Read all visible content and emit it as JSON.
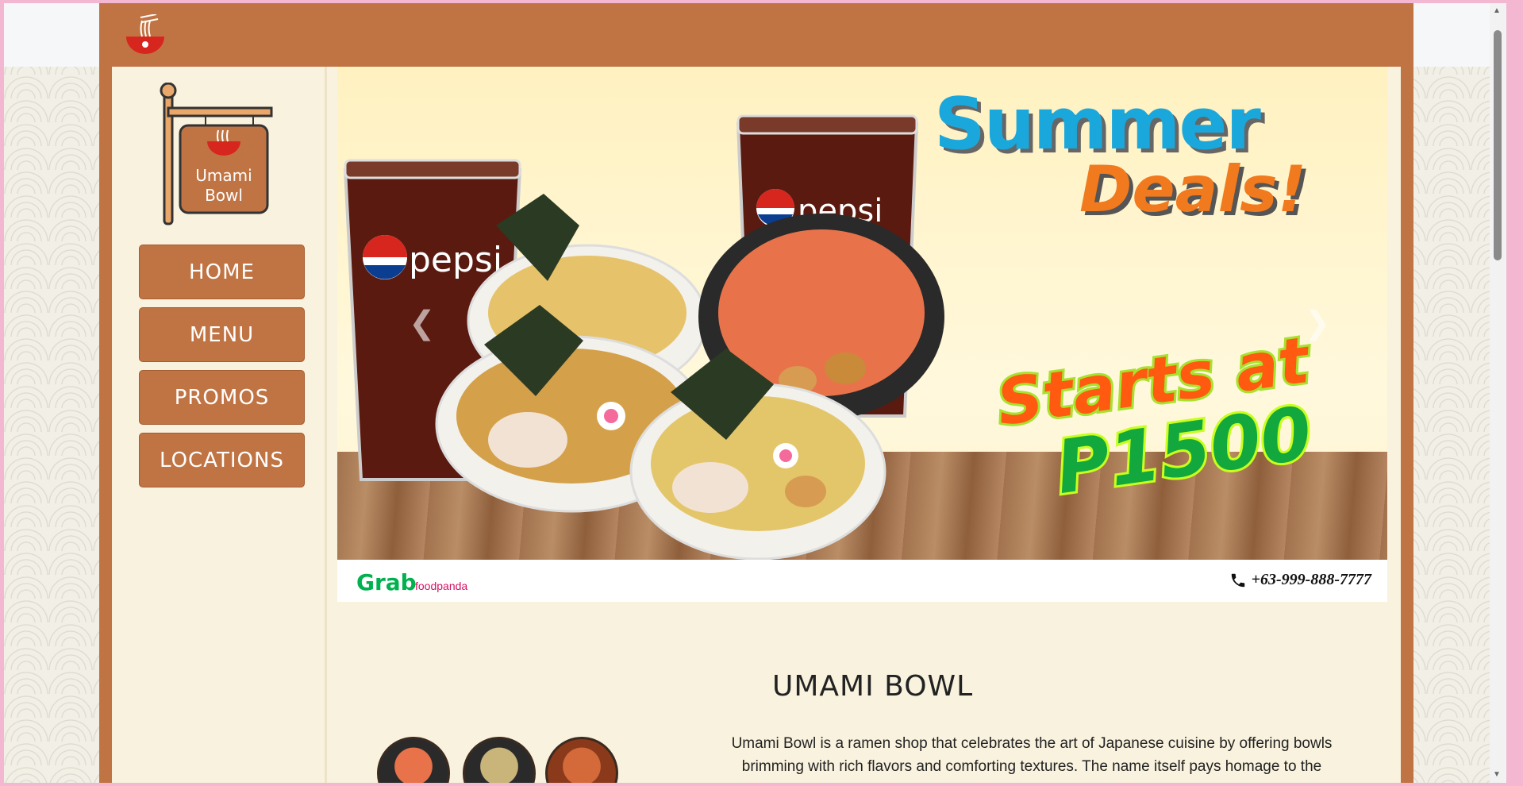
{
  "header": {
    "logo_icon": "ramen-bowl-icon"
  },
  "sidebar": {
    "sign_name_line1": "Umami",
    "sign_name_line2": "Bowl",
    "items": [
      {
        "label": "HOME"
      },
      {
        "label": "MENU"
      },
      {
        "label": "PROMOS"
      },
      {
        "label": "LOCATIONS"
      }
    ]
  },
  "banner": {
    "headline_1": "Summer",
    "headline_2": "Deals!",
    "headline_3": "Starts at",
    "headline_4": "P1500",
    "cup_brand": "pepsi",
    "delivery_1": "Grab",
    "delivery_2": "foodpanda",
    "phone": "+63-999-888-7777",
    "prev_icon": "chevron-left-icon",
    "next_icon": "chevron-right-icon"
  },
  "about": {
    "title": "UMAMI BOWL",
    "text": "Umami Bowl is a ramen shop that celebrates the art of Japanese cuisine by offering bowls brimming with rich flavors and comforting textures. The name itself pays homage to the"
  },
  "colors": {
    "brand": "#c07444",
    "panel": "#f9f2de",
    "accent_blue": "#1aa8dc",
    "accent_orange": "#f07a1d",
    "accent_green": "#13a83d"
  }
}
